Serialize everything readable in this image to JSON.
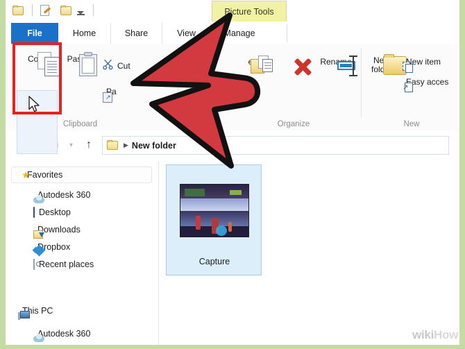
{
  "window": {
    "contextual_tab_group": "Picture Tools"
  },
  "quick_access": {
    "items": [
      {
        "name": "folder-icon",
        "label": "Folder"
      },
      {
        "name": "new-document-icon",
        "label": "New document"
      },
      {
        "name": "properties-folder-icon",
        "label": "Properties"
      },
      {
        "name": "customize-chevron-icon",
        "label": "Customize Quick Access Toolbar"
      }
    ]
  },
  "tabs": [
    {
      "id": "file",
      "label": "File"
    },
    {
      "id": "home",
      "label": "Home"
    },
    {
      "id": "share",
      "label": "Share"
    },
    {
      "id": "view",
      "label": "View"
    },
    {
      "id": "manage",
      "label": "Manage"
    }
  ],
  "ribbon": {
    "groups": [
      {
        "id": "clipboard",
        "label": "Clipboard"
      },
      {
        "id": "organize",
        "label": "Organize"
      },
      {
        "id": "new",
        "label": "New"
      }
    ],
    "clipboard": {
      "copy": "Copy",
      "paste": "Paste",
      "cut": "Cut",
      "paste_shortcut": "Pa"
    },
    "organize": {
      "copy_to": "e",
      "rename": "Rename"
    },
    "new": {
      "new_folder_line1": "New",
      "new_folder_line2": "folder",
      "new_item": "New item",
      "easy_access": "Easy acces"
    }
  },
  "address_bar": {
    "back": "←",
    "forward": "→",
    "recent": "▾",
    "up": "↑",
    "breadcrumb": "New folder"
  },
  "navigation_pane": {
    "sections": [
      {
        "header": "Favorites",
        "header_icon": "star-icon",
        "items": [
          {
            "label": "Autodesk 360",
            "icon": "cloud-icon"
          },
          {
            "label": "Desktop",
            "icon": "desktop-icon"
          },
          {
            "label": "Downloads",
            "icon": "downloads-icon"
          },
          {
            "label": "Dropbox",
            "icon": "dropbox-icon"
          },
          {
            "label": "Recent places",
            "icon": "recent-places-icon"
          }
        ]
      },
      {
        "header": "This PC",
        "header_icon": "computer-icon",
        "items": [
          {
            "label": "Autodesk 360",
            "icon": "cloud-icon"
          }
        ]
      }
    ]
  },
  "content": {
    "files": [
      {
        "name": "Capture",
        "selected": true
      }
    ]
  },
  "annotations": {
    "highlight_target": "Copy",
    "arrow_color": "#d33a3f",
    "highlight_color": "#e8201e"
  },
  "watermark": {
    "wiki": "wiki",
    "how": "How"
  }
}
